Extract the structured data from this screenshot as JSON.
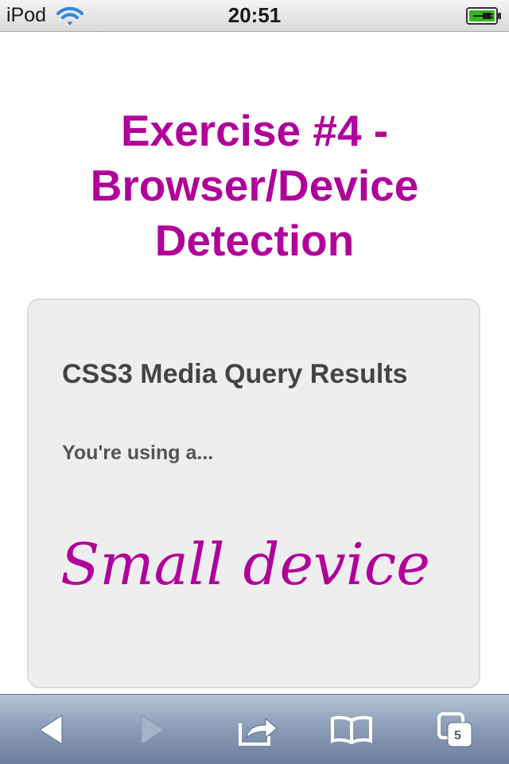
{
  "status_bar": {
    "carrier": "iPod",
    "time": "20:51",
    "wifi_icon": "wifi-icon",
    "battery_icon": "battery-charging-icon"
  },
  "page": {
    "title": "Exercise #4 - Browser/Device Detection",
    "card": {
      "heading": "CSS3 Media Query Results",
      "prompt": "You're using a...",
      "result": "Small device"
    },
    "colors": {
      "accent": "#b0009a",
      "card_background": "#eeeeee",
      "heading_text": "#444444"
    }
  },
  "toolbar": {
    "back_icon": "back-arrow-icon",
    "forward_icon": "forward-arrow-icon",
    "share_icon": "share-icon",
    "bookmarks_icon": "bookmarks-book-icon",
    "tabs_icon": "tabs-pages-icon",
    "tabs_count": "5"
  }
}
